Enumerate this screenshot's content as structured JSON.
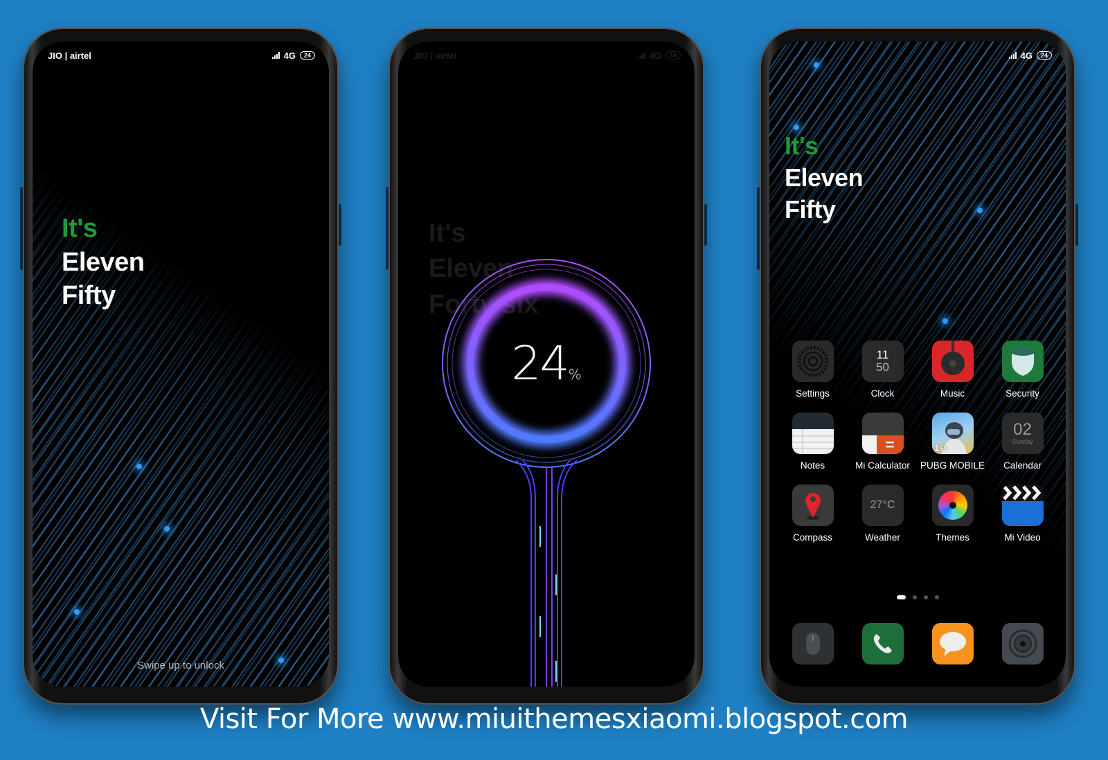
{
  "background_color": "#1e7fc3",
  "status_bar": {
    "carrier": "JIO | airtel",
    "network": "4G",
    "battery": "24"
  },
  "lock_screen": {
    "clock_line1": "It's",
    "clock_line2": "Eleven",
    "clock_line3": "Fifty",
    "swipe_hint": "Swipe up to unlock",
    "accent_color": "#1f9a3a"
  },
  "charging_screen": {
    "percent_value": "24",
    "percent_sign": "%",
    "ghost_clock_line1": "It's",
    "ghost_clock_line2": "Eleven",
    "ghost_clock_line3": "Forty six",
    "ring_colors": [
      "#b04cff",
      "#4f7bff"
    ]
  },
  "home_screen": {
    "clock_line1": "It's",
    "clock_line2": "Eleven",
    "clock_line3": "Fifty",
    "apps": [
      {
        "label": "Settings",
        "icon": "settings-gear-icon"
      },
      {
        "label": "Clock",
        "icon": "clock-icon",
        "hour": "11",
        "minute": "50"
      },
      {
        "label": "Music",
        "icon": "music-headphone-icon"
      },
      {
        "label": "Security",
        "icon": "security-shield-icon"
      },
      {
        "label": "Notes",
        "icon": "notes-icon"
      },
      {
        "label": "Mi Calculator",
        "icon": "calculator-icon"
      },
      {
        "label": "PUBG MOBILE",
        "icon": "pubg-game-icon",
        "badge": "1st"
      },
      {
        "label": "Calendar",
        "icon": "calendar-icon",
        "day": "02",
        "weekday": "Sunday"
      },
      {
        "label": "Compass",
        "icon": "compass-pin-icon"
      },
      {
        "label": "Weather",
        "icon": "weather-icon",
        "temp": "27°C"
      },
      {
        "label": "Themes",
        "icon": "themes-color-wheel-icon"
      },
      {
        "label": "Mi Video",
        "icon": "video-clapper-icon"
      }
    ],
    "page_indicator": {
      "total": 4,
      "active": 1
    },
    "dock": [
      {
        "icon": "mouse-icon"
      },
      {
        "icon": "phone-icon"
      },
      {
        "icon": "messages-icon"
      },
      {
        "icon": "camera-icon"
      }
    ]
  },
  "footer": {
    "text": "Visit For More www.miuithemesxiaomi.blogspot.com"
  }
}
